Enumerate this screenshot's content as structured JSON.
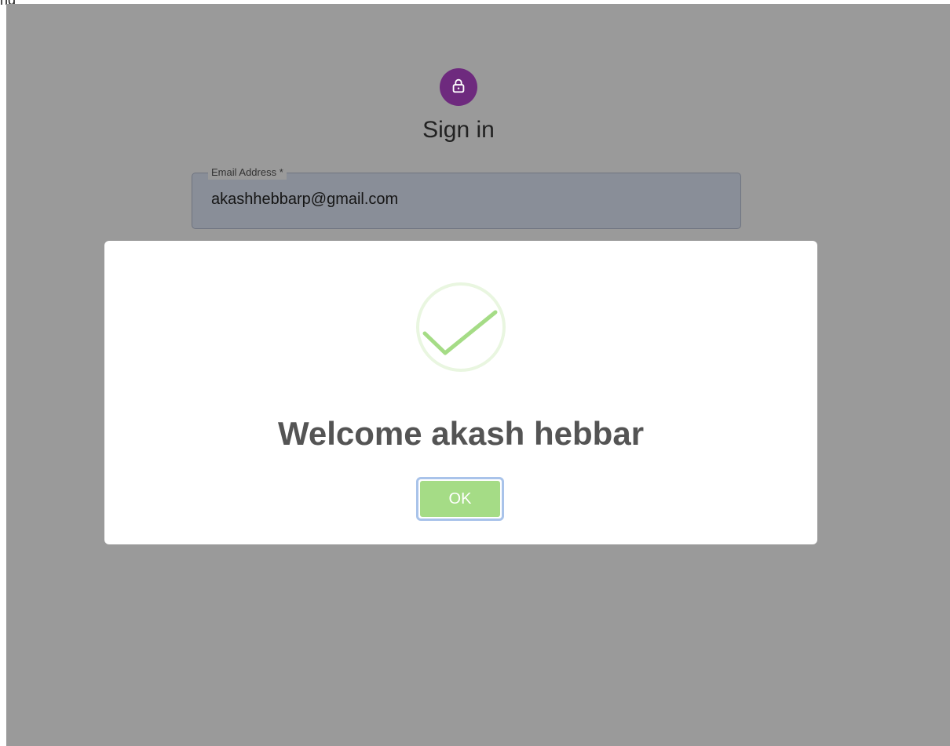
{
  "page": {
    "corner_text": "ng"
  },
  "signin": {
    "title": "Sign in",
    "lock_icon": "lock-icon",
    "email_label": "Email Address *",
    "email_value": "akashhebbarp@gmail.com"
  },
  "dialog": {
    "icon": "check-circle-icon",
    "message": "Welcome akash hebbar",
    "ok_label": "OK"
  },
  "colors": {
    "overlay": "#9a9a9a",
    "avatar": "#6e2a7e",
    "success_green": "#a5dc86",
    "dialog_text": "#545454"
  }
}
